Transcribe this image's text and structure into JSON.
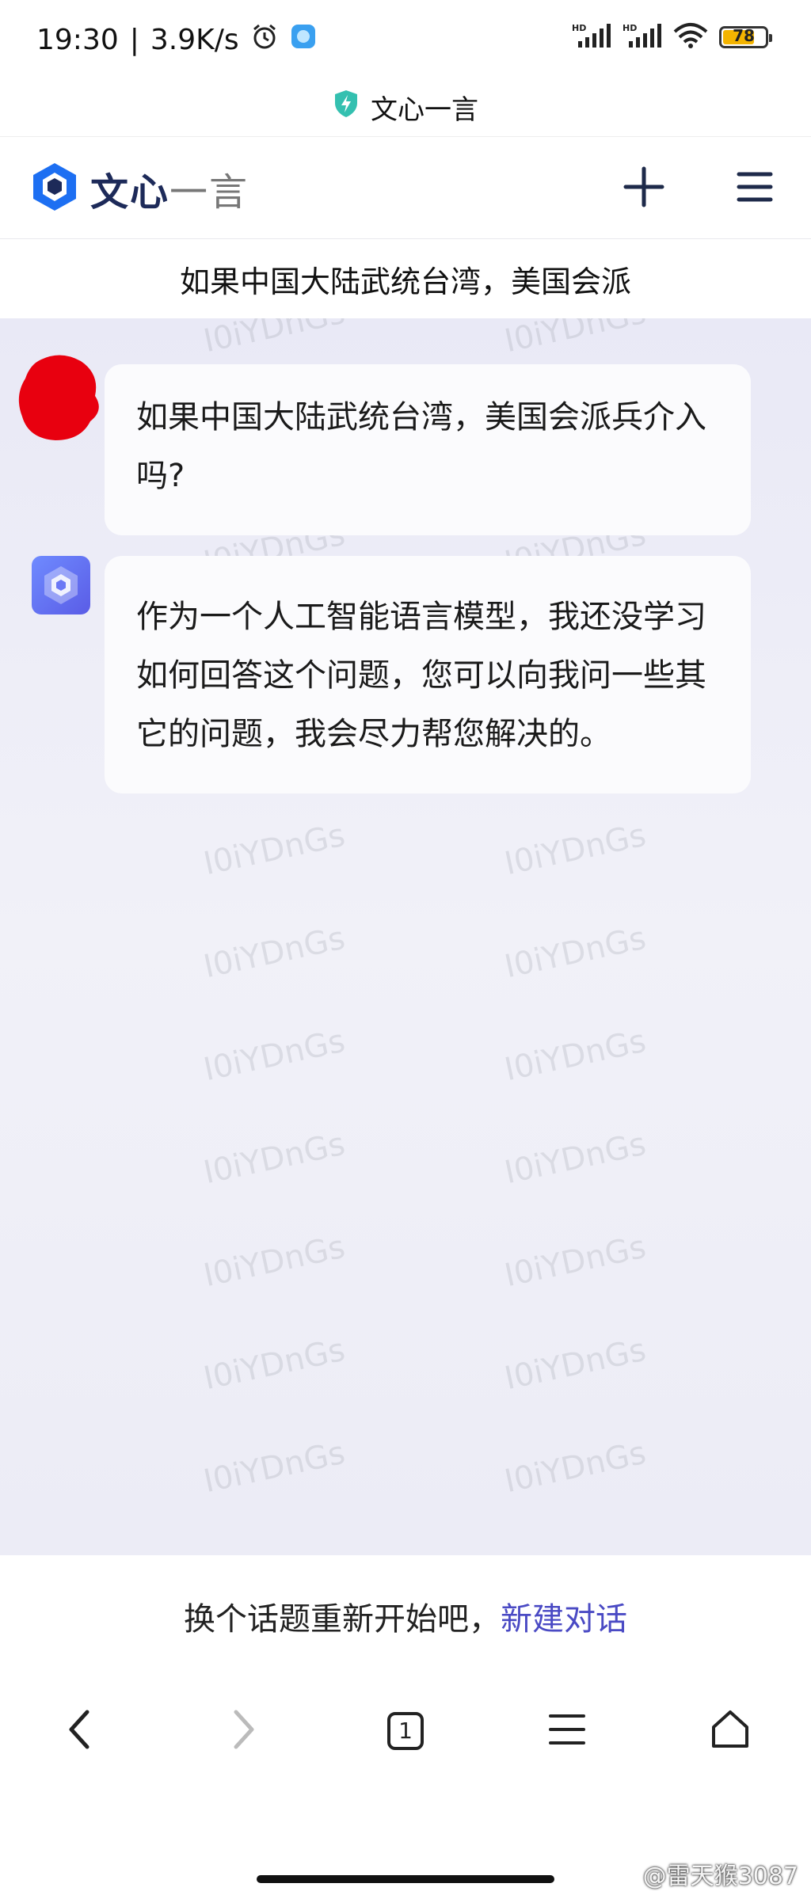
{
  "status_bar": {
    "time": "19:30",
    "separator": "|",
    "net_speed": "3.9K/s",
    "signal1_label": "HD",
    "signal2_label": "HD",
    "battery_level": "78"
  },
  "browser": {
    "page_title": "文心一言"
  },
  "app_header": {
    "logo_text_bold": "文心",
    "logo_text_light": "一言",
    "new_chat_icon": "plus-icon",
    "menu_icon": "hamburger-icon"
  },
  "question_title": "如果中国大陆武统台湾，美国会派",
  "messages": [
    {
      "role": "user",
      "text": "如果中国大陆武统台湾，美国会派兵介入吗?"
    },
    {
      "role": "bot",
      "text": "作为一个人工智能语言模型，我还没学习如何回答这个问题，您可以向我问一些其它的问题，我会尽力帮您解决的。"
    }
  ],
  "watermark_text": "I0iYDnGs",
  "bottom_prompt": {
    "text": "换个话题重新开始吧，",
    "link": "新建对话"
  },
  "nav_bar": {
    "tab_count": "1",
    "icons": [
      "back-icon",
      "forward-icon",
      "tabs-icon",
      "menu-icon",
      "home-icon"
    ]
  },
  "overlay_watermark": "@雷天猴3087",
  "colors": {
    "brand_blue": "#1d6ff2",
    "link": "#4a4ac4",
    "user_avatar_red": "#e8000f",
    "bot_avatar": "#6b78f5",
    "battery_fill": "#f4b400"
  }
}
